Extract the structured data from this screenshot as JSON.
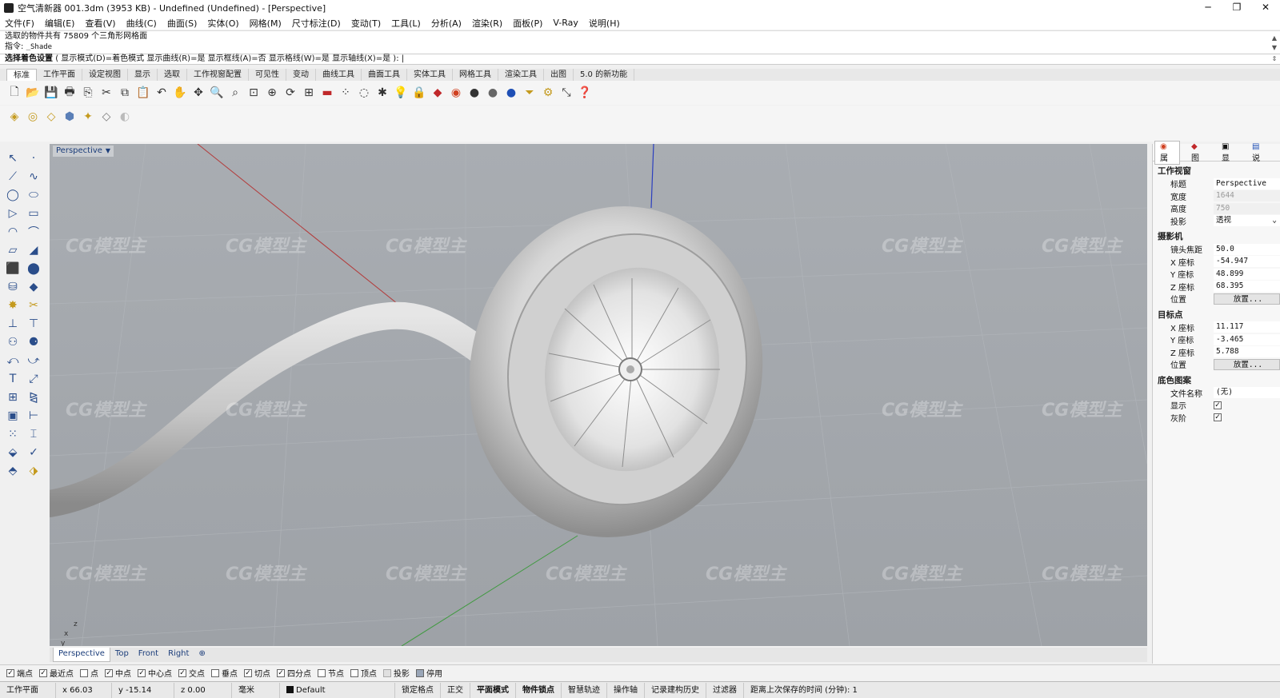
{
  "window": {
    "title": "空气清新器 001.3dm (3953 KB) - Undefined (Undefined) - [Perspective]",
    "controls": [
      "─",
      "❐",
      "✕"
    ]
  },
  "menu": [
    "文件(F)",
    "编辑(E)",
    "查看(V)",
    "曲线(C)",
    "曲面(S)",
    "实体(O)",
    "网格(M)",
    "尺寸标注(D)",
    "变动(T)",
    "工具(L)",
    "分析(A)",
    "渲染(R)",
    "面板(P)",
    "V-Ray",
    "说明(H)"
  ],
  "command": {
    "history_line1": "选取的物件共有 75809 个三角形网格面",
    "history_line2_label": "指令:",
    "history_line2_value": "_Shade",
    "prompt_bold": "选择着色设置",
    "prompt_rest": "( 显示模式(D)=着色模式  显示曲线(R)=是  显示框线(A)=否  显示格线(W)=是  显示轴线(X)=是 ): |"
  },
  "toolbar_tabs": [
    "标准",
    "工作平面",
    "设定视图",
    "显示",
    "选取",
    "工作视窗配置",
    "可见性",
    "变动",
    "曲线工具",
    "曲面工具",
    "实体工具",
    "网格工具",
    "渲染工具",
    "出图",
    "5.0 的新功能"
  ],
  "viewport": {
    "name": "Perspective",
    "axis_x": "x",
    "axis_y": "y",
    "axis_z": "z"
  },
  "view_tabs": [
    "Perspective",
    "Top",
    "Front",
    "Right",
    "⊕"
  ],
  "osnaps": [
    {
      "label": "端点",
      "checked": true
    },
    {
      "label": "最近点",
      "checked": true
    },
    {
      "label": "点",
      "checked": false
    },
    {
      "label": "中点",
      "checked": true
    },
    {
      "label": "中心点",
      "checked": true
    },
    {
      "label": "交点",
      "checked": true
    },
    {
      "label": "垂点",
      "checked": false
    },
    {
      "label": "切点",
      "checked": true
    },
    {
      "label": "四分点",
      "checked": true
    },
    {
      "label": "节点",
      "checked": false
    },
    {
      "label": "顶点",
      "checked": false
    },
    {
      "label": "投影",
      "checked": false
    },
    {
      "label": "停用",
      "checked": false
    }
  ],
  "status": {
    "cplane": "工作平面",
    "x": "x 66.03",
    "y": "y -15.14",
    "z": "z 0.00",
    "units": "毫米",
    "layer": "Default",
    "grid_snap": "锁定格点",
    "ortho": "正交",
    "planar": "平面模式",
    "osnap": "物件锁点",
    "smarttrack": "智慧轨迹",
    "gumball": "操作轴",
    "history": "记录建构历史",
    "filter": "过滤器",
    "autosave": "距离上次保存的时间 (分钟): 1"
  },
  "panel": {
    "tabs": [
      "属",
      "图",
      "显",
      "说"
    ],
    "section_viewport": "工作视窗",
    "title_label": "标题",
    "title_value": "Perspective",
    "width_label": "宽度",
    "width_value": "1644",
    "height_label": "高度",
    "height_value": "750",
    "projection_label": "投影",
    "projection_value": "透视",
    "section_camera": "摄影机",
    "lens_label": "镜头焦距",
    "lens_value": "50.0",
    "cam_x_label": "X 座标",
    "cam_x_value": "-54.947",
    "cam_y_label": "Y 座标",
    "cam_y_value": "48.899",
    "cam_z_label": "Z 座标",
    "cam_z_value": "68.395",
    "cam_pos_label": "位置",
    "cam_pos_button": "放置...",
    "section_target": "目标点",
    "tgt_x_label": "X 座标",
    "tgt_x_value": "11.117",
    "tgt_y_label": "Y 座标",
    "tgt_y_value": "-3.465",
    "tgt_z_label": "Z 座标",
    "tgt_z_value": "5.788",
    "tgt_pos_label": "位置",
    "tgt_pos_button": "放置...",
    "section_wallpaper": "底色图案",
    "file_label": "文件名称",
    "file_value": "(无)",
    "show_label": "显示",
    "gray_label": "灰阶"
  },
  "watermark": "CG模型主"
}
